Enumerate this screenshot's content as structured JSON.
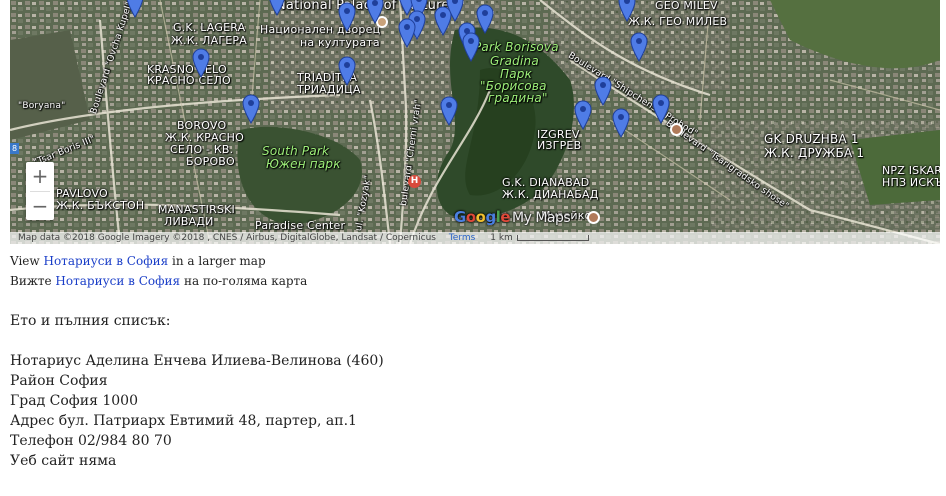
{
  "map": {
    "labels": {
      "national_palace_en": "National Palace of Culture",
      "national_palace_bg_1": "Национален дворец",
      "national_palace_bg_2": "на културата",
      "lagera_en": "G.K. LAGERA",
      "lagera_bg": "Ж.К. ЛАГЕРА",
      "geo_milev_en": "GEO MILEV",
      "geo_milev_bg": "Ж.К. ГЕО МИЛЕВ",
      "krasno_selo_en": "KRASNO SELO",
      "krasno_selo_bg": "КРАСНО СЕЛО",
      "triaditsa_en": "TRIADITSA",
      "triaditsa_bg": "ТРИАДИЦА",
      "park_borisova_1": "Park Borisova",
      "park_borisova_2": "Gradina",
      "park_borisova_bg_1": "Парк",
      "park_borisova_bg_2": "\"Борисова",
      "park_borisova_bg_3": "градина\"",
      "boryana": "\"Boryana\"",
      "borovo_en": "BOROVO",
      "borovo_bg_1": "Ж.К. КРАСНО",
      "borovo_bg_2": "СЕЛО - КВ.",
      "borovo_bg_3": "БОРОВО",
      "south_park_en": "South Park",
      "south_park_bg": "Южен парк",
      "izgrev_en": "IZGREV",
      "izgrev_bg": "ИЗГРЕВ",
      "druzhba_en": "GK DRUZHBA 1",
      "druzhba_bg": "Ж.К. ДРУЖБА 1",
      "iskar_en": "NPZ ISKAR",
      "iskar_bg": "НПЗ ИСКЪР",
      "pavlovo_en": "PAVLOVO",
      "pavlovo_bg": "Ж.К. БЪКСТОН",
      "manastirski_en": "MANASTIRSKI",
      "manastirski_bg": "ЛИВАДИ",
      "dianabad_en": "G.K. DIANABAD",
      "dianabad_bg": "Ж.К. ДИАНАБАД",
      "paradise": "Paradise Center",
      "muzeiko": "Музейко",
      "shipchenski": "Boulevard \"Shipchenski Prohod\"",
      "tsarigradsko": "Boulevard \"Tsarigradsko shose\"",
      "cherni_vrah": "bulevard \"Cherni vrah\"",
      "kozyak": "ul. \"Kozyak\"",
      "ochenski": "Boulevard \"Ovcha Kupel\"",
      "tsar_boris": "\"Tsar Boris III\""
    },
    "zoom_in": "+",
    "zoom_out": "−",
    "scale_chip": "8",
    "attribution": "Map data ©2018 Google Imagery ©2018 , CNES / Airbus, DigitalGlobe, Landsat / Copernicus",
    "terms": "Terms",
    "scale": "1 km",
    "logo": {
      "g": "G",
      "o1": "o",
      "o2": "o",
      "g2": "g",
      "l": "l",
      "e": "e",
      "mymaps": "My Maps"
    },
    "icons": [
      "map-marker-icon",
      "hospital-icon",
      "museum-icon",
      "palace-icon"
    ]
  },
  "links": {
    "en_prefix": "View ",
    "en_link": "Нотариуси в София",
    "en_suffix": " in a larger map",
    "bg_prefix": "Вижте ",
    "bg_link": "Нотариуси в София",
    "bg_suffix": " на по-голяма карта"
  },
  "content": {
    "intro": "Ето и пълния списък:",
    "notary_name": "Нотариус Аделина Енчева Илиева-Велинова (460)",
    "region": "Район София",
    "city": "Град София 1000",
    "address": "Адрес бул. Патриарх Евтимий 48, партер, ап.1",
    "phone": "Телефон 02/984 80 70",
    "website": "Уеб сайт няма"
  }
}
